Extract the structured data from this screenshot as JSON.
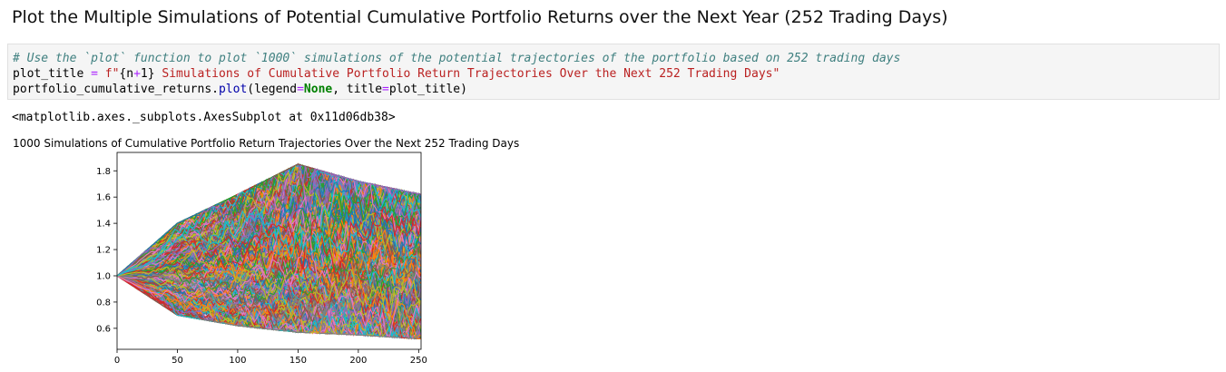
{
  "heading": "Plot the Multiple Simulations of Potential Cumulative Portfolio Returns over the Next Year (252 Trading Days)",
  "code": {
    "line1_comment": "# Use the `plot` function to plot `1000` simulations of the potential trajectories of the portfolio based on 252 trading days",
    "line2": {
      "var": "plot_title ",
      "eq": "=",
      "f_prefix": " f\"",
      "interp_open": "{n",
      "plus": "+",
      "interp_close": "1}",
      "str": " Simulations of Cumulative Portfolio Return Trajectories Over the Next 252 Trading Days\""
    },
    "line3": {
      "obj": "portfolio_cumulative_returns.",
      "method": "plot",
      "open": "(legend",
      "eq1": "=",
      "none_kw": "None",
      "mid": ", title",
      "eq2": "=",
      "close": "plot_title)"
    }
  },
  "output_repr": "<matplotlib.axes._subplots.AxesSubplot at 0x11d06db38>",
  "chart_data": {
    "type": "line",
    "title": "1000 Simulations of Cumulative Portfolio Return Trajectories Over the Next 252 Trading Days",
    "xlim": [
      0,
      252
    ],
    "ylim": [
      0.44,
      1.94
    ],
    "xticks": [
      0,
      50,
      100,
      150,
      200,
      250
    ],
    "yticks": [
      0.6,
      0.8,
      1.0,
      1.2,
      1.4,
      1.6,
      1.8
    ],
    "xtick_labels": [
      "0",
      "50",
      "100",
      "150",
      "200",
      "250"
    ],
    "ytick_labels": [
      "0.6",
      "0.8",
      "1.0",
      "1.2",
      "1.4",
      "1.6",
      "1.8"
    ],
    "n_simulations": 1000,
    "x_start": 0,
    "x_end": 252,
    "start_value": 1.0,
    "envelope": {
      "x": [
        0,
        50,
        100,
        150,
        200,
        252
      ],
      "upper": [
        1.0,
        1.4,
        1.62,
        1.85,
        1.72,
        1.62
      ],
      "lower": [
        1.0,
        0.7,
        0.62,
        0.57,
        0.55,
        0.52
      ],
      "median": [
        1.0,
        1.03,
        1.06,
        1.08,
        1.1,
        1.1
      ]
    },
    "legend": "none",
    "grid": false,
    "colors": [
      "#1f77b4",
      "#ff7f0e",
      "#2ca02c",
      "#d62728",
      "#9467bd",
      "#8c564b",
      "#e377c2",
      "#7f7f7f",
      "#bcbd22",
      "#17becf"
    ]
  }
}
